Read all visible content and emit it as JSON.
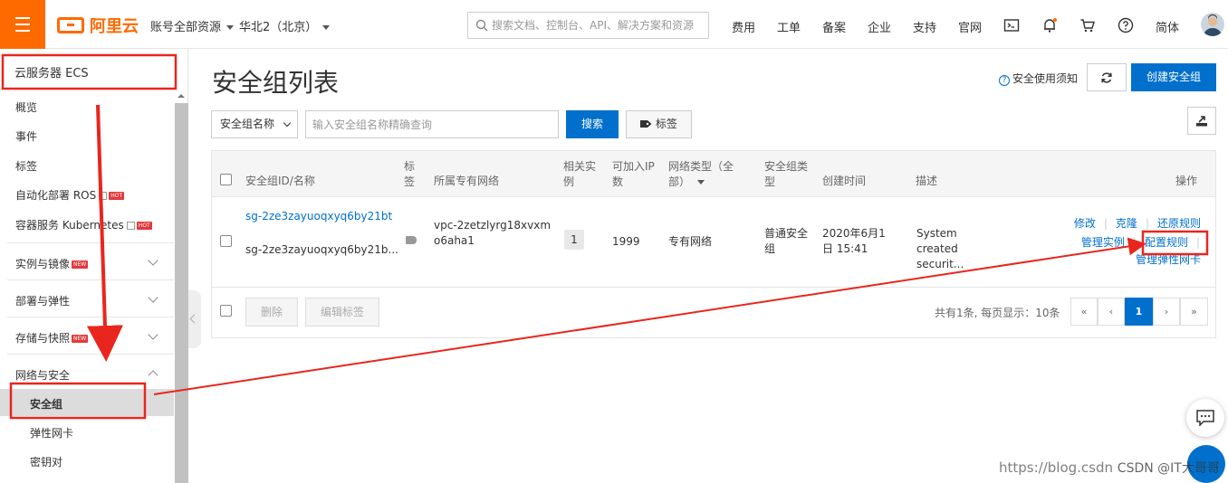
{
  "brand": {
    "name": "阿里云",
    "accent": "#ff6a00",
    "primary": "#0070cc"
  },
  "topbar": {
    "account_scope": "账号全部资源",
    "region": "华北2（北京）",
    "search_placeholder": "搜索文档、控制台、API、解决方案和资源",
    "nav": [
      "费用",
      "工单",
      "备案",
      "企业",
      "支持",
      "官网"
    ],
    "language": "简体"
  },
  "sidebar": {
    "title": "云服务器 ECS",
    "items": [
      {
        "label": "概览"
      },
      {
        "label": "事件"
      },
      {
        "label": "标签"
      },
      {
        "label": "自动化部署 ROS",
        "badge": "HOT"
      },
      {
        "label": "容器服务 Kubernetes",
        "badge": "HOT"
      }
    ],
    "groups": [
      {
        "label": "实例与镜像",
        "badge": "NEW"
      },
      {
        "label": "部署与弹性"
      },
      {
        "label": "存储与快照",
        "badge": "NEW"
      },
      {
        "label": "网络与安全"
      }
    ],
    "sub_items": [
      "安全组",
      "弹性网卡",
      "密钥对"
    ]
  },
  "main": {
    "title": "安全组列表",
    "help_link": "安全使用须知",
    "create_button": "创建安全组",
    "filter_select": "安全组名称",
    "filter_placeholder": "输入安全组名称精确查询",
    "search_button": "搜索",
    "tag_button": "标签"
  },
  "table": {
    "headers": {
      "id": "安全组ID/名称",
      "tag": "标签",
      "vpc": "所属专有网络",
      "related": "相关实例",
      "ip": "可加入IP数",
      "nettype": "网络类型（全部）",
      "sgtype": "安全组类型",
      "created": "创建时间",
      "desc": "描述",
      "ops": "操作"
    },
    "row": {
      "id": "sg-2ze3zayuoqxyq6by21bt",
      "name": "sg-2ze3zayuoqxyq6by21b...",
      "vpc": "vpc-2zetzlyrg18xvxmo6aha1",
      "related": "1",
      "ip": "1999",
      "nettype": "专有网络",
      "sgtype": "普通安全组",
      "created": "2020年6月1日 15:41",
      "desc": "System created securit...",
      "ops": {
        "modify": "修改",
        "clone": "克隆",
        "restore": "还原规则",
        "manage_instances": "管理实例",
        "config_rules": "配置规则",
        "manage_eni": "管理弹性网卡"
      }
    },
    "footer": {
      "delete": "删除",
      "edit_tags": "编辑标签",
      "summary": "共有1条, 每页显示：10条",
      "pager": [
        "«",
        "‹",
        "1",
        "›",
        "»"
      ]
    }
  },
  "watermark": "https://blog.csdn",
  "watermark_overlay": "CSDN @IT大哥哥"
}
